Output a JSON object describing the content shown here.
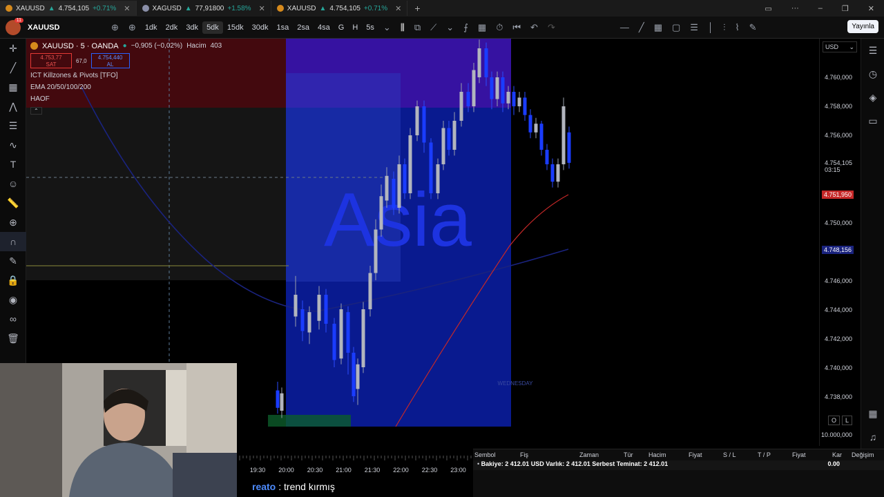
{
  "browser_tabs": [
    {
      "symbol": "XAUUSD",
      "price": "4.754,105",
      "change": "+0.71%",
      "active": true
    },
    {
      "symbol": "XAGUSD",
      "price": "77,91800",
      "change": "+1.58%",
      "active": false
    },
    {
      "symbol": "XAUUSD",
      "price": "4.754,105",
      "change": "+0.71%",
      "active": false
    }
  ],
  "toolbar": {
    "avatar_badge": "11",
    "symbol": "XAUUSD",
    "timeframes": [
      "1dk",
      "2dk",
      "3dk",
      "5dk",
      "15dk",
      "30dk",
      "1sa",
      "2sa",
      "4sa",
      "G",
      "H",
      "5s"
    ],
    "selected_timeframe": "5dk",
    "publish_label": "Yayınla"
  },
  "legend": {
    "title": "XAUUSD · 5 · OANDA",
    "change": "−0,905 (−0,02%)",
    "volume_label": "Hacim",
    "volume_value": "403",
    "sell_price": "4.753,77",
    "sell_label": "SAT",
    "spread": "67,0",
    "buy_price": "4.754,440",
    "buy_label": "AL",
    "indicators": [
      "ICT Killzones & Pivots [TFO]",
      "EMA 20/50/100/200",
      "HAOF"
    ]
  },
  "price_axis": {
    "currency": "USD",
    "ticks": [
      "4.760,000",
      "4.758,000",
      "4.756,000",
      "4.750,000",
      "4.746,000",
      "4.744,000",
      "4.742,000",
      "4.740,000",
      "4.738,000",
      "10.000,000"
    ],
    "last_price": "4.754,105",
    "countdown": "03:15",
    "red_marker": "4.751,950",
    "blue_marker": "4.748,156"
  },
  "chart": {
    "session_label": "Asia",
    "day_label": "WEDNESDAY",
    "colors": {
      "session_box": "#0a1fa8",
      "bull_candle": "#b2b5be",
      "ema_red": "#c62828",
      "ema_blue": "#1a237e"
    }
  },
  "time_axis": [
    "19:30",
    "20:00",
    "20:30",
    "21:00",
    "21:30",
    "22:00",
    "22:30",
    "23:00"
  ],
  "trading_panel": {
    "columns": [
      "Sembol",
      "Fiş",
      "Zaman",
      "Tür",
      "Hacim",
      "Fiyat",
      "S / L",
      "T / P",
      "Fiyat",
      "Kar",
      "Değişim"
    ],
    "balance_text": "Bakiye: 2 412.01 USD  Varlık: 2 412.01  Serbest Teminat: 2 412.01",
    "profit": "0.00"
  },
  "chat": {
    "user": "reato",
    "message": ": trend kırmış"
  },
  "chart_buttons": [
    "O",
    "L"
  ]
}
